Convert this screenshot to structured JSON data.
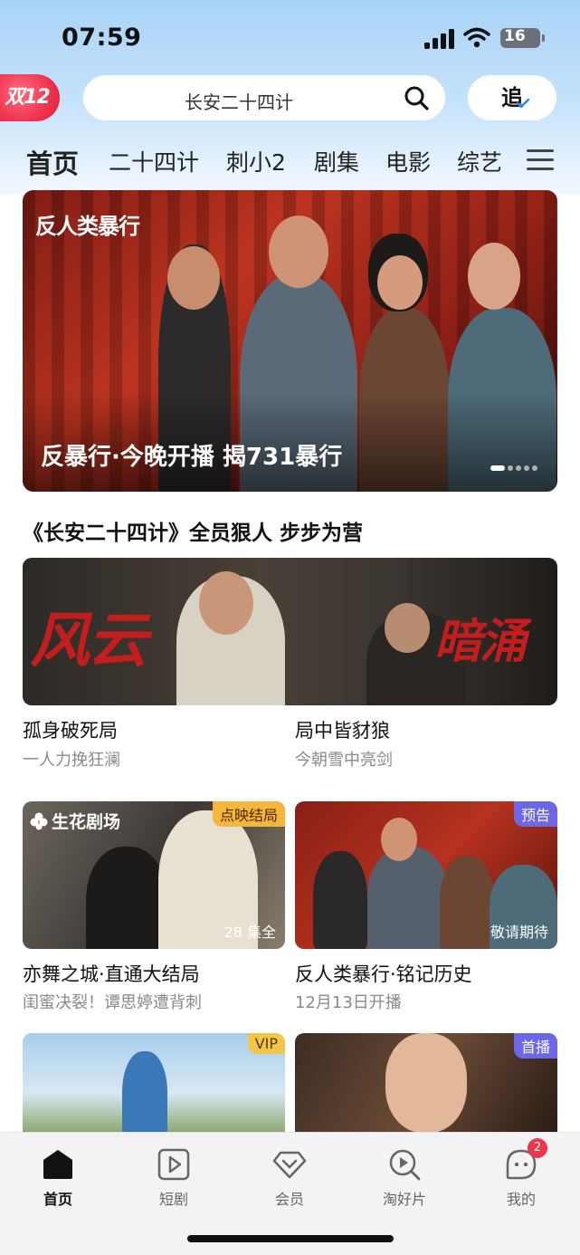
{
  "status_bar": {
    "time": "07:59",
    "battery": "16"
  },
  "header": {
    "promo_badge": "双12",
    "search_placeholder": "长安二十四计",
    "follow_label": "追"
  },
  "nav_tabs": [
    {
      "label": "首页",
      "active": true
    },
    {
      "label": "二十四计"
    },
    {
      "label": "刺小2"
    },
    {
      "label": "剧集"
    },
    {
      "label": "电影"
    },
    {
      "label": "综艺"
    }
  ],
  "hero": {
    "logo_text": "反人类暴行",
    "caption": "反暴行·今晚开播 揭731暴行",
    "slides": 5,
    "active_slide": 0
  },
  "section": {
    "title": "《长安二十四计》全员狠人 步步为营",
    "banner_left_text": "风云",
    "banner_right_text": "暗涌",
    "items": [
      {
        "title": "孤身破死局",
        "subtitle": "一人力挽狂澜"
      },
      {
        "title": "局中皆豺狼",
        "subtitle": "今朝雪中亮剑"
      }
    ]
  },
  "grid": [
    {
      "title": "亦舞之城·直通大结局",
      "subtitle": "闺蜜决裂！谭思婷遭背刺",
      "tag": "点映结局",
      "bottom_label": "28 集全",
      "studio": "生花剧场"
    },
    {
      "title": "反人类暴行·铭记历史",
      "subtitle": "12月13日开播",
      "tag": "预告",
      "bottom_label": "敬请期待"
    },
    {
      "tag": "VIP"
    },
    {
      "tag": "首播"
    }
  ],
  "bottom_nav": [
    {
      "label": "首页",
      "active": true
    },
    {
      "label": "短剧"
    },
    {
      "label": "会员"
    },
    {
      "label": "淘好片"
    },
    {
      "label": "我的",
      "badge": "2"
    }
  ]
}
